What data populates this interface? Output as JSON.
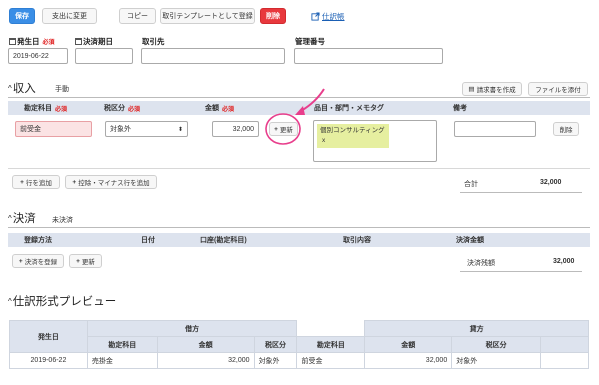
{
  "toolbar": {
    "save": "保存",
    "change_to_expense": "支出に変更",
    "copy": "コピー",
    "register_template": "取引テンプレートとして登録",
    "delete": "削除",
    "journal_link": "仕訳帳"
  },
  "header_fields": {
    "date_label": "発生日",
    "date_required": "必須",
    "date_value": "2019-06-22",
    "due_label": "決済期日",
    "partner_label": "取引先",
    "manage_no_label": "管理番号"
  },
  "income": {
    "title": "収入",
    "mode": "手動",
    "create_invoice": "請求書を作成",
    "attach_file": "ファイルを添付",
    "columns": {
      "account": "勘定科目",
      "tax": "税区分",
      "amount": "金額",
      "required": "必須",
      "tags": "品目・部門・メモタグ",
      "note": "備考"
    },
    "row": {
      "account": "前受金",
      "tax": "対象外",
      "amount": "32,000",
      "update": "更新",
      "tag": "個別コンサルティング",
      "tag_remove": "x",
      "delete": "削除"
    },
    "add_row": "行を追加",
    "add_deduction": "控除・マイナス行を追加",
    "total_label": "合計",
    "total_value": "32,000"
  },
  "settlement": {
    "title": "決済",
    "status": "未決済",
    "columns": {
      "method": "登録方法",
      "date": "日付",
      "account": "口座(勘定科目)",
      "content": "取引内容",
      "amount": "決済金額"
    },
    "register": "決済を登録",
    "update": "更新",
    "balance_label": "決済残額",
    "balance_value": "32,000"
  },
  "preview": {
    "title": "仕訳形式プレビュー",
    "date_header": "発生日",
    "debit": "借方",
    "credit": "貸方",
    "account": "勘定科目",
    "amount": "金額",
    "tax": "税区分",
    "row": {
      "date": "2019-06-22",
      "debit_account": "売掛金",
      "debit_amount": "32,000",
      "debit_tax": "対象外",
      "credit_account": "前受金",
      "credit_amount": "32,000",
      "credit_tax": "対象外"
    }
  },
  "colors": {
    "primary": "#3a8ee6",
    "danger": "#e8383d",
    "highlight": "#e83e8c",
    "tag_bg": "#e6efa0",
    "required_input_bg": "#fbe3e4"
  }
}
